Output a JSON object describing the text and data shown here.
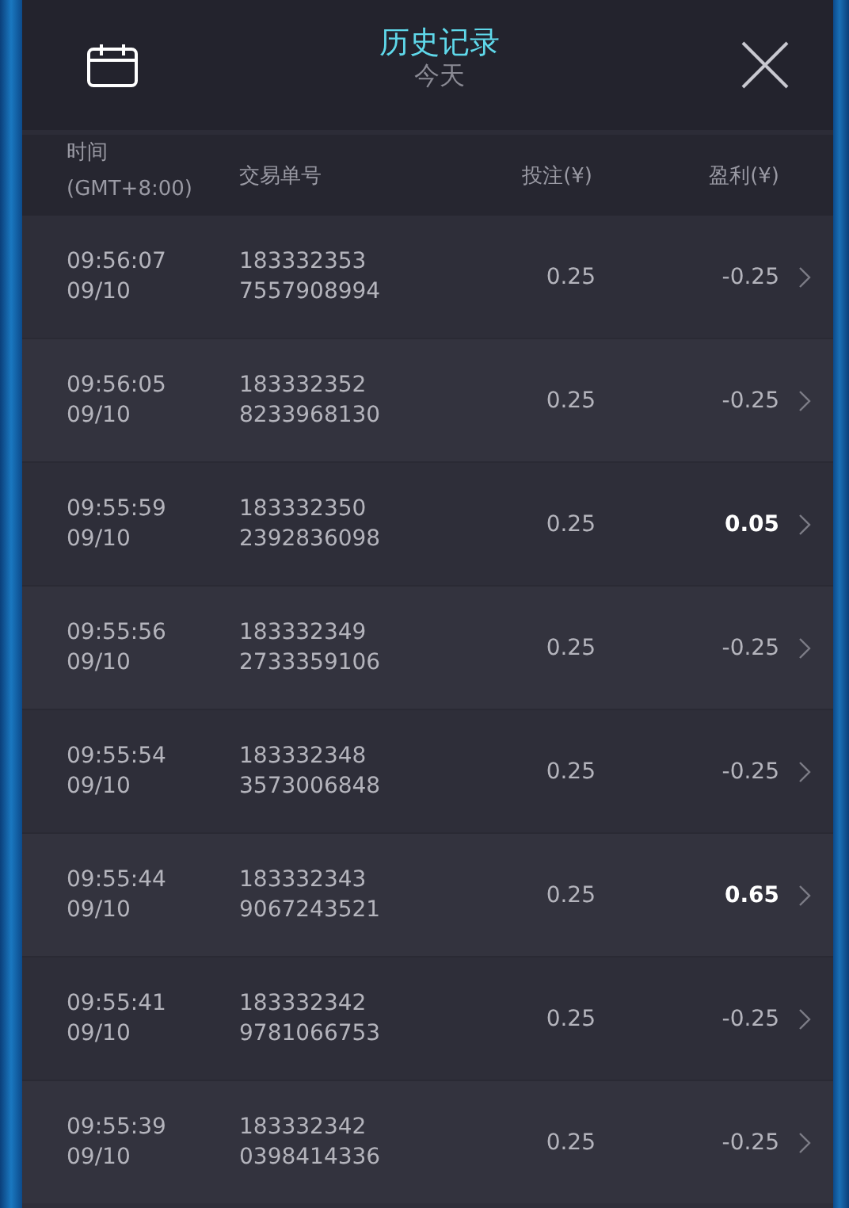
{
  "header": {
    "title": "历史记录",
    "subtitle": "今天"
  },
  "columns": {
    "time": "时间",
    "timezone": "(GMT+8:00)",
    "order": "交易单号",
    "bet": "投注(¥)",
    "profit": "盈利(¥)"
  },
  "rows": [
    {
      "time": "09:56:07",
      "date": "09/10",
      "order_line1": "183332353",
      "order_line2": "7557908994",
      "bet": "0.25",
      "profit": "-0.25",
      "kind": "loss"
    },
    {
      "time": "09:56:05",
      "date": "09/10",
      "order_line1": "183332352",
      "order_line2": "8233968130",
      "bet": "0.25",
      "profit": "-0.25",
      "kind": "loss"
    },
    {
      "time": "09:55:59",
      "date": "09/10",
      "order_line1": "183332350",
      "order_line2": "2392836098",
      "bet": "0.25",
      "profit": "0.05",
      "kind": "win"
    },
    {
      "time": "09:55:56",
      "date": "09/10",
      "order_line1": "183332349",
      "order_line2": "2733359106",
      "bet": "0.25",
      "profit": "-0.25",
      "kind": "loss"
    },
    {
      "time": "09:55:54",
      "date": "09/10",
      "order_line1": "183332348",
      "order_line2": "3573006848",
      "bet": "0.25",
      "profit": "-0.25",
      "kind": "loss"
    },
    {
      "time": "09:55:44",
      "date": "09/10",
      "order_line1": "183332343",
      "order_line2": "9067243521",
      "bet": "0.25",
      "profit": "0.65",
      "kind": "win"
    },
    {
      "time": "09:55:41",
      "date": "09/10",
      "order_line1": "183332342",
      "order_line2": "9781066753",
      "bet": "0.25",
      "profit": "-0.25",
      "kind": "loss"
    },
    {
      "time": "09:55:39",
      "date": "09/10",
      "order_line1": "183332342",
      "order_line2": "0398414336",
      "bet": "0.25",
      "profit": "-0.25",
      "kind": "loss"
    }
  ]
}
